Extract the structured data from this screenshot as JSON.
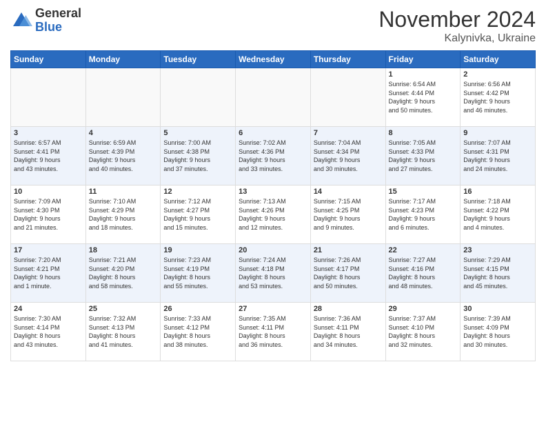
{
  "logo": {
    "general": "General",
    "blue": "Blue"
  },
  "header": {
    "month": "November 2024",
    "location": "Kalynivka, Ukraine"
  },
  "weekdays": [
    "Sunday",
    "Monday",
    "Tuesday",
    "Wednesday",
    "Thursday",
    "Friday",
    "Saturday"
  ],
  "weeks": [
    [
      {
        "day": "",
        "info": ""
      },
      {
        "day": "",
        "info": ""
      },
      {
        "day": "",
        "info": ""
      },
      {
        "day": "",
        "info": ""
      },
      {
        "day": "",
        "info": ""
      },
      {
        "day": "1",
        "info": "Sunrise: 6:54 AM\nSunset: 4:44 PM\nDaylight: 9 hours\nand 50 minutes."
      },
      {
        "day": "2",
        "info": "Sunrise: 6:56 AM\nSunset: 4:42 PM\nDaylight: 9 hours\nand 46 minutes."
      }
    ],
    [
      {
        "day": "3",
        "info": "Sunrise: 6:57 AM\nSunset: 4:41 PM\nDaylight: 9 hours\nand 43 minutes."
      },
      {
        "day": "4",
        "info": "Sunrise: 6:59 AM\nSunset: 4:39 PM\nDaylight: 9 hours\nand 40 minutes."
      },
      {
        "day": "5",
        "info": "Sunrise: 7:00 AM\nSunset: 4:38 PM\nDaylight: 9 hours\nand 37 minutes."
      },
      {
        "day": "6",
        "info": "Sunrise: 7:02 AM\nSunset: 4:36 PM\nDaylight: 9 hours\nand 33 minutes."
      },
      {
        "day": "7",
        "info": "Sunrise: 7:04 AM\nSunset: 4:34 PM\nDaylight: 9 hours\nand 30 minutes."
      },
      {
        "day": "8",
        "info": "Sunrise: 7:05 AM\nSunset: 4:33 PM\nDaylight: 9 hours\nand 27 minutes."
      },
      {
        "day": "9",
        "info": "Sunrise: 7:07 AM\nSunset: 4:31 PM\nDaylight: 9 hours\nand 24 minutes."
      }
    ],
    [
      {
        "day": "10",
        "info": "Sunrise: 7:09 AM\nSunset: 4:30 PM\nDaylight: 9 hours\nand 21 minutes."
      },
      {
        "day": "11",
        "info": "Sunrise: 7:10 AM\nSunset: 4:29 PM\nDaylight: 9 hours\nand 18 minutes."
      },
      {
        "day": "12",
        "info": "Sunrise: 7:12 AM\nSunset: 4:27 PM\nDaylight: 9 hours\nand 15 minutes."
      },
      {
        "day": "13",
        "info": "Sunrise: 7:13 AM\nSunset: 4:26 PM\nDaylight: 9 hours\nand 12 minutes."
      },
      {
        "day": "14",
        "info": "Sunrise: 7:15 AM\nSunset: 4:25 PM\nDaylight: 9 hours\nand 9 minutes."
      },
      {
        "day": "15",
        "info": "Sunrise: 7:17 AM\nSunset: 4:23 PM\nDaylight: 9 hours\nand 6 minutes."
      },
      {
        "day": "16",
        "info": "Sunrise: 7:18 AM\nSunset: 4:22 PM\nDaylight: 9 hours\nand 4 minutes."
      }
    ],
    [
      {
        "day": "17",
        "info": "Sunrise: 7:20 AM\nSunset: 4:21 PM\nDaylight: 9 hours\nand 1 minute."
      },
      {
        "day": "18",
        "info": "Sunrise: 7:21 AM\nSunset: 4:20 PM\nDaylight: 8 hours\nand 58 minutes."
      },
      {
        "day": "19",
        "info": "Sunrise: 7:23 AM\nSunset: 4:19 PM\nDaylight: 8 hours\nand 55 minutes."
      },
      {
        "day": "20",
        "info": "Sunrise: 7:24 AM\nSunset: 4:18 PM\nDaylight: 8 hours\nand 53 minutes."
      },
      {
        "day": "21",
        "info": "Sunrise: 7:26 AM\nSunset: 4:17 PM\nDaylight: 8 hours\nand 50 minutes."
      },
      {
        "day": "22",
        "info": "Sunrise: 7:27 AM\nSunset: 4:16 PM\nDaylight: 8 hours\nand 48 minutes."
      },
      {
        "day": "23",
        "info": "Sunrise: 7:29 AM\nSunset: 4:15 PM\nDaylight: 8 hours\nand 45 minutes."
      }
    ],
    [
      {
        "day": "24",
        "info": "Sunrise: 7:30 AM\nSunset: 4:14 PM\nDaylight: 8 hours\nand 43 minutes."
      },
      {
        "day": "25",
        "info": "Sunrise: 7:32 AM\nSunset: 4:13 PM\nDaylight: 8 hours\nand 41 minutes."
      },
      {
        "day": "26",
        "info": "Sunrise: 7:33 AM\nSunset: 4:12 PM\nDaylight: 8 hours\nand 38 minutes."
      },
      {
        "day": "27",
        "info": "Sunrise: 7:35 AM\nSunset: 4:11 PM\nDaylight: 8 hours\nand 36 minutes."
      },
      {
        "day": "28",
        "info": "Sunrise: 7:36 AM\nSunset: 4:11 PM\nDaylight: 8 hours\nand 34 minutes."
      },
      {
        "day": "29",
        "info": "Sunrise: 7:37 AM\nSunset: 4:10 PM\nDaylight: 8 hours\nand 32 minutes."
      },
      {
        "day": "30",
        "info": "Sunrise: 7:39 AM\nSunset: 4:09 PM\nDaylight: 8 hours\nand 30 minutes."
      }
    ]
  ]
}
